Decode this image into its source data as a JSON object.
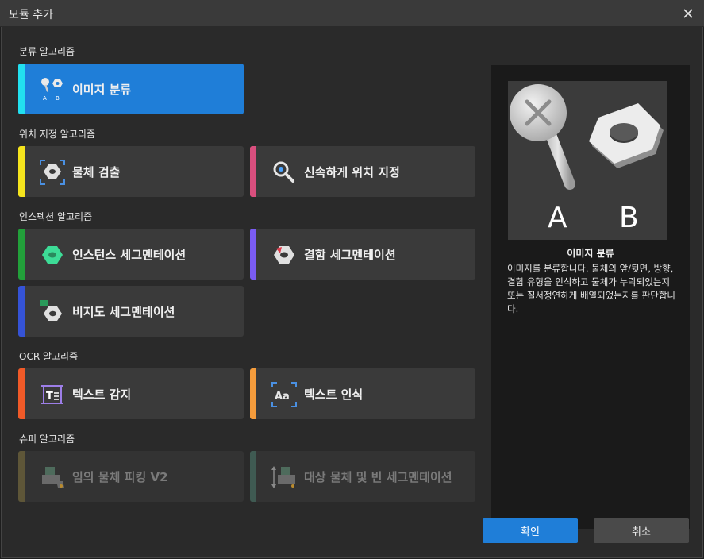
{
  "window": {
    "title": "모듈 추가"
  },
  "sections": {
    "classification": "분류 알고리즘",
    "location": "위치 지정 알고리즘",
    "inspection": "인스펙션 알고리즘",
    "ocr": "OCR 알고리즘",
    "super": "슈퍼 알고리즘"
  },
  "cards": {
    "image_classification": "이미지 분류",
    "object_detection": "물체 검출",
    "fast_positioning": "신속하게 위치 지정",
    "instance_segmentation": "인스턴스 세그멘테이션",
    "defect_segmentation": "결함 세그멘테이션",
    "unsupervised_segmentation": "비지도 세그멘테이션",
    "text_detection": "텍스트 감지",
    "text_recognition": "텍스트 인식",
    "picking_v2": "임의 물체 피킹 V2",
    "object_bin_segmentation": "대상 물체 및 빈 세그멘테이션"
  },
  "preview": {
    "label_a": "A",
    "label_b": "B",
    "title": "이미지 분류",
    "description": "이미지를 분류합니다. 물체의 앞/뒷면, 방향, 결합 유형을 인식하고 물체가 누락되었는지 또는 질서정연하게 배열되었는지를 판단합니다."
  },
  "buttons": {
    "ok": "확인",
    "cancel": "취소"
  },
  "colors": {
    "accent": "#1f7ed8",
    "stripe_classification": "#22e0ef",
    "stripe_object_detection": "#f5e41d",
    "stripe_fast_positioning": "#d94f7e",
    "stripe_instance": "#22a03a",
    "stripe_defect": "#7a5cf2",
    "stripe_unsupervised": "#3553d6",
    "stripe_text_detection": "#f05a28",
    "stripe_text_recognition": "#f59c3c",
    "stripe_picking": "#5e5638",
    "stripe_bin": "#3f5a52"
  }
}
